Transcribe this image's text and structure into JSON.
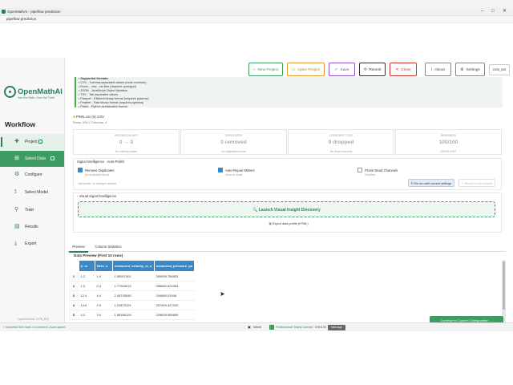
{
  "window": {
    "title": "OpenMathAI - pipeflow prediction",
    "min": "–",
    "max": "□",
    "close": "✕"
  },
  "pathbar": {
    "text": "pipeflow prediction"
  },
  "app": {
    "name": "OpenMathAI",
    "tagline": "See the Math, Own the Truth",
    "version": "OpenMathAI 2026_BIS"
  },
  "workflow": {
    "title": "Workflow",
    "items": [
      {
        "label": "Project",
        "icon": "✚"
      },
      {
        "label": "Select Data",
        "icon": "⊞"
      },
      {
        "label": "Configure",
        "icon": "⚙"
      },
      {
        "label": "Select Model",
        "icon": "⟟"
      },
      {
        "label": "Train",
        "icon": "⚲"
      },
      {
        "label": "Results",
        "icon": "▤"
      },
      {
        "label": "Export",
        "icon": "⤓"
      }
    ]
  },
  "toolbar": {
    "new": "New Project",
    "open": "Open Project",
    "save": "Save",
    "recent": "Recent",
    "close": "Close",
    "about": "About",
    "settings": "Settings",
    "date": "2026_BIS",
    "icons": {
      "new": "+",
      "open": "▭",
      "save": "✓",
      "recent": "⟲",
      "close": "✕",
      "about": "i",
      "settings": "⚙"
    }
  },
  "formats": [
    "• Supported formats:",
    "• CSV - Comma-separated values (most common)",
    "• Excel - .xlsx, .xls files (requires openpyxl)",
    "• JSON - JavaScript Object Notation",
    "• TSV - Tab-separated values",
    "• Parquet - Efficient binary format (requires pyarrow)",
    "• Feather - Fast binary format (requires pyarrow)",
    "• Pickle - Python serialization format"
  ],
  "file": {
    "name": "PINN.csv (6) CSV",
    "rows": "Rows: 500 | Columns: 4"
  },
  "cards": [
    {
      "title": "MISSING VALUES",
      "value": "0 → 0",
      "sub": "No missing values"
    },
    {
      "title": "DUPLICATES",
      "value": "0 removed",
      "sub": "No duplicates found"
    },
    {
      "title": "CONSTANT COLS",
      "value": "0 dropped",
      "sub": "No dead channels"
    },
    {
      "title": "READINESS",
      "value": "100/100",
      "sub": "EXCELLENT"
    }
  ],
  "signal": {
    "title": "Signal Intelligence · Auto-Polish",
    "remove_dup": {
      "label": "Remove Duplicates",
      "sub": "No duplicates found"
    },
    "impute": {
      "label": "Auto-Repair Misses",
      "sub": "None to repair"
    },
    "prune": {
      "label": "Prune Dead Channels",
      "sub": "Disabled"
    },
    "last_note": "Last polish: no changes needed",
    "rerun": "↻ Re-run with current settings",
    "revert": "↶ Revert to raw dataset"
  },
  "visual": {
    "title": "Visual Signal Intelligence",
    "launch": "🔍 Launch Visual Insight Discovery",
    "export": "Export data profile (HTML)"
  },
  "tabs": {
    "preview": "Preview",
    "stats": "Column Statistics"
  },
  "preview": {
    "title": "Data Preview (First 10 rows)",
    "columns": [
      "k_m",
      "Nres_s",
      "measured_velocity_m_s",
      "measured_pressure_pa"
    ],
    "rows": [
      [
        "1",
        "1.2",
        "1.0",
        "1.55907401",
        "269099.756833"
      ],
      [
        "2",
        "1.0",
        "0.4",
        "1.77300013",
        "256082.624354"
      ],
      [
        "3",
        "12.4",
        "4.4",
        "2.45745549",
        "249469.01946"
      ],
      [
        "4",
        "14.6",
        "2.9",
        "1.01873124",
        "257459.427202"
      ],
      [
        "5",
        "4.2",
        "3.0",
        "1.55180124",
        "229635.955659"
      ]
    ]
  },
  "continue": "Continue to Column Configuration →",
  "status": {
    "left": "✓ Imported 500 rows • 4 columns | Auto-saved",
    "license_icon": "▣",
    "license_name": "Weeb",
    "license_status": "Professional Yearly License",
    "license_id": "ENNUM",
    "manage": "Manage"
  }
}
